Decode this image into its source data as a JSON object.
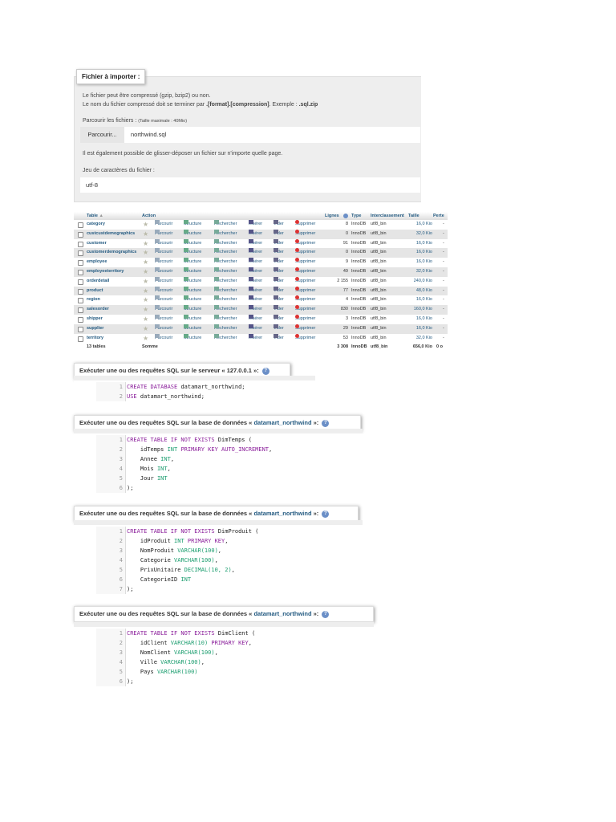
{
  "import": {
    "legend": "Fichier à importer :",
    "line1": "Le fichier peut être compressé (gzip, bzip2) ou non.",
    "line2a": "Le nom du fichier compressé doit se terminer par ",
    "line2b": ".[format].[compression]",
    "line2c": ". Exemple : ",
    "line2d": ".sql.zip",
    "browse_label": "Parcourir les fichiers :",
    "max_size": "(Taille maximale : 40Mio)",
    "browse_button": "Parcourir...",
    "file_name": "northwind.sql",
    "drag_hint": "Il est également possible de glisser-déposer un fichier sur n'importe quelle page.",
    "charset_label": "Jeu de caractères du fichier :",
    "charset_value": "utf-8"
  },
  "tables": {
    "headers": {
      "table": "Table",
      "sort": "▲",
      "action": "Action",
      "rows": "Lignes",
      "type": "Type",
      "collation": "Interclassement",
      "size": "Taille",
      "overhead": "Perte"
    },
    "actions": [
      "Parcourir",
      "Structure",
      "Rechercher",
      "Insérer",
      "Vider",
      "Supprimer"
    ],
    "rows": [
      {
        "name": "category",
        "rows": "8",
        "type": "InnoDB",
        "collation": "utf8_bin",
        "size": "16,0 Kio",
        "overhead": "-"
      },
      {
        "name": "custcustdemographics",
        "rows": "0",
        "type": "InnoDB",
        "collation": "utf8_bin",
        "size": "32,0 Kio",
        "overhead": "-"
      },
      {
        "name": "customer",
        "rows": "91",
        "type": "InnoDB",
        "collation": "utf8_bin",
        "size": "16,0 Kio",
        "overhead": "-"
      },
      {
        "name": "customerdemographics",
        "rows": "0",
        "type": "InnoDB",
        "collation": "utf8_bin",
        "size": "16,0 Kio",
        "overhead": "-"
      },
      {
        "name": "employee",
        "rows": "9",
        "type": "InnoDB",
        "collation": "utf8_bin",
        "size": "16,0 Kio",
        "overhead": "-"
      },
      {
        "name": "employeeterritory",
        "rows": "49",
        "type": "InnoDB",
        "collation": "utf8_bin",
        "size": "32,0 Kio",
        "overhead": "-"
      },
      {
        "name": "orderdetail",
        "rows": "2 155",
        "type": "InnoDB",
        "collation": "utf8_bin",
        "size": "240,0 Kio",
        "overhead": "-"
      },
      {
        "name": "product",
        "rows": "77",
        "type": "InnoDB",
        "collation": "utf8_bin",
        "size": "48,0 Kio",
        "overhead": "-"
      },
      {
        "name": "region",
        "rows": "4",
        "type": "InnoDB",
        "collation": "utf8_bin",
        "size": "16,0 Kio",
        "overhead": "-"
      },
      {
        "name": "salesorder",
        "rows": "830",
        "type": "InnoDB",
        "collation": "utf8_bin",
        "size": "160,0 Kio",
        "overhead": "-"
      },
      {
        "name": "shipper",
        "rows": "3",
        "type": "InnoDB",
        "collation": "utf8_bin",
        "size": "16,0 Kio",
        "overhead": "-"
      },
      {
        "name": "supplier",
        "rows": "29",
        "type": "InnoDB",
        "collation": "utf8_bin",
        "size": "16,0 Kio",
        "overhead": "-"
      },
      {
        "name": "territory",
        "rows": "53",
        "type": "InnoDB",
        "collation": "utf8_bin",
        "size": "32,0 Kio",
        "overhead": "-"
      }
    ],
    "footer": {
      "count": "13 tables",
      "label": "Somme",
      "rows": "3 308",
      "type": "InnoDB",
      "collation": "utf8_bin",
      "size": "656,0 Kio",
      "overhead": "0 o"
    }
  },
  "sql_blocks": [
    {
      "title": "Exécuter une ou des requêtes SQL sur le serveur « 127.0.0.1 »:",
      "db": "",
      "title_end": "",
      "lines": [
        [
          [
            "kw",
            "CREATE DATABASE "
          ],
          [
            "id",
            "datamart_northwind;"
          ]
        ],
        [
          [
            "kw",
            "USE "
          ],
          [
            "id",
            "datamart_northwind;"
          ]
        ]
      ]
    },
    {
      "title": "Exécuter une ou des requêtes SQL sur la base de données « ",
      "db": "datamart_northwind",
      "title_end": " »:",
      "lines": [
        [
          [
            "kw",
            "CREATE TABLE IF NOT EXISTS "
          ],
          [
            "id",
            "DimTemps ("
          ]
        ],
        [
          [
            "id",
            "    idTemps "
          ],
          [
            "ty",
            "INT "
          ],
          [
            "kw",
            "PRIMARY KEY AUTO_INCREMENT"
          ],
          [
            "id",
            ","
          ]
        ],
        [
          [
            "id",
            "    Annee "
          ],
          [
            "ty",
            "INT"
          ],
          [
            "id",
            ","
          ]
        ],
        [
          [
            "id",
            "    Mois "
          ],
          [
            "ty",
            "INT"
          ],
          [
            "id",
            ","
          ]
        ],
        [
          [
            "id",
            "    Jour "
          ],
          [
            "ty",
            "INT"
          ]
        ],
        [
          [
            "id",
            ");"
          ]
        ]
      ]
    },
    {
      "title": "Exécuter une ou des requêtes SQL sur la base de données « ",
      "db": "datamart_northwind",
      "title_end": " »:",
      "lines": [
        [
          [
            "kw",
            "CREATE TABLE IF NOT EXISTS "
          ],
          [
            "id",
            "DimProduit ("
          ]
        ],
        [
          [
            "id",
            "    idProduit "
          ],
          [
            "ty",
            "INT "
          ],
          [
            "kw",
            "PRIMARY KEY"
          ],
          [
            "id",
            ","
          ]
        ],
        [
          [
            "id",
            "    NomProduit "
          ],
          [
            "ty",
            "VARCHAR(100)"
          ],
          [
            "id",
            ","
          ]
        ],
        [
          [
            "id",
            "    Categorie "
          ],
          [
            "ty",
            "VARCHAR(100)"
          ],
          [
            "id",
            ","
          ]
        ],
        [
          [
            "id",
            "    PrixUnitaire "
          ],
          [
            "ty",
            "DECIMAL(10, 2)"
          ],
          [
            "id",
            ","
          ]
        ],
        [
          [
            "id",
            "    CategorieID "
          ],
          [
            "ty",
            "INT"
          ]
        ],
        [
          [
            "id",
            ");"
          ]
        ]
      ]
    },
    {
      "title": "Exécuter une ou des requêtes SQL sur la base de données « ",
      "db": "datamart_northwind",
      "title_end": " »:",
      "lines": [
        [
          [
            "kw",
            "CREATE TABLE IF NOT EXISTS "
          ],
          [
            "id",
            "DimClient ("
          ]
        ],
        [
          [
            "id",
            "    idClient "
          ],
          [
            "ty",
            "VARCHAR(10) "
          ],
          [
            "kw",
            "PRIMARY KEY"
          ],
          [
            "id",
            ","
          ]
        ],
        [
          [
            "id",
            "    NomClient "
          ],
          [
            "ty",
            "VARCHAR(100)"
          ],
          [
            "id",
            ","
          ]
        ],
        [
          [
            "id",
            "    Ville "
          ],
          [
            "ty",
            "VARCHAR(100)"
          ],
          [
            "id",
            ","
          ]
        ],
        [
          [
            "id",
            "    Pays "
          ],
          [
            "ty",
            "VARCHAR(100)"
          ]
        ],
        [
          [
            "id",
            ");"
          ]
        ]
      ]
    }
  ]
}
